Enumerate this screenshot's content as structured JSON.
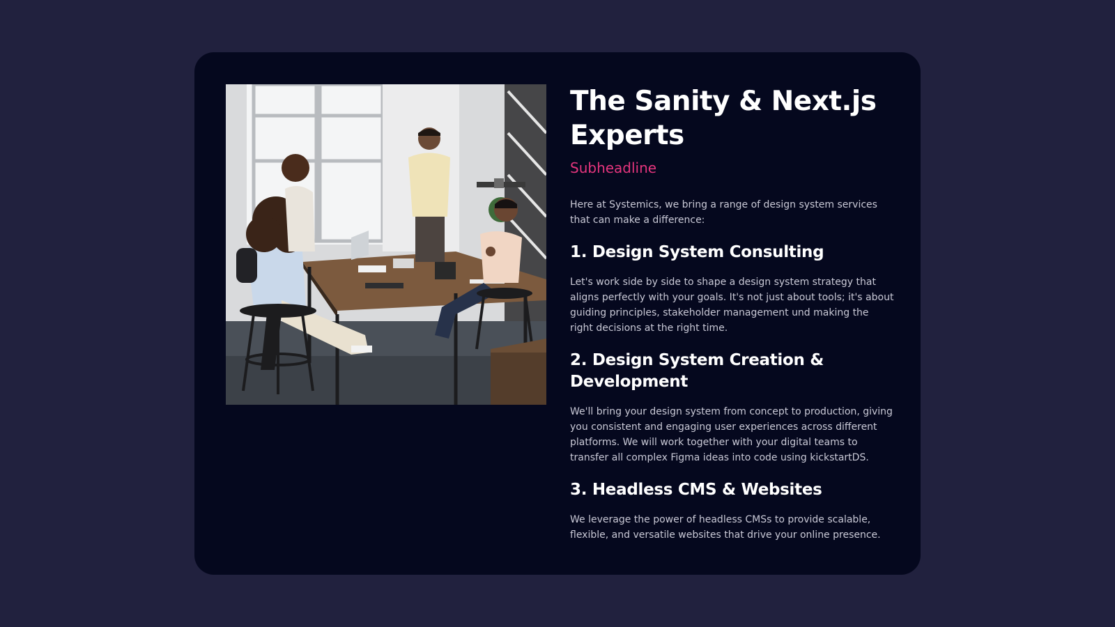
{
  "page": {
    "background": "#21213e",
    "card_background": "#05081e"
  },
  "image": {
    "icon": "office-team-photo"
  },
  "content": {
    "title": "The Sanity & Next.js Experts",
    "subheadline": "Subheadline",
    "subheadline_color": "#e5357d",
    "intro": "Here at Systemics, we bring a range of design system services that can make a difference:",
    "sections": [
      {
        "heading": "1. Design System Consulting",
        "body": "Let's work side by side to shape a design system strategy that aligns perfectly with your goals. It's not just about tools; it's about guiding principles, stakeholder management und making the right decisions at the right time."
      },
      {
        "heading": "2. Design System Creation & Development",
        "body": "We'll bring your design system from concept to production, giving you consistent and engaging user experiences across different platforms. We will work together with your digital teams to transfer all complex Figma ideas into code using kickstartDS."
      },
      {
        "heading": "3. Headless CMS & Websites",
        "body": "We leverage the power of headless CMSs to provide scalable, flexible, and versatile websites that drive your online presence."
      }
    ]
  }
}
